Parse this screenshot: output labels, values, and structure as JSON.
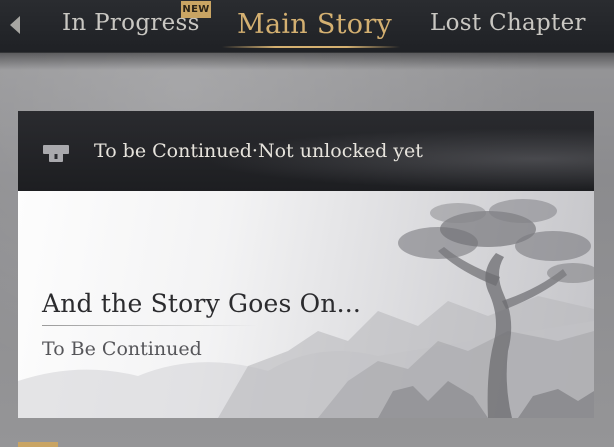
{
  "tabs": {
    "in_progress": "In Progress",
    "main_story": "Main Story",
    "lost_chapter": "Lost Chapter",
    "new_badge": "NEW",
    "active": "main_story"
  },
  "card": {
    "status_text": "To be Continued·Not unlocked yet",
    "title": "And the Story Goes On...",
    "subtitle": "To Be Continued",
    "lock_icon": "lock-icon"
  },
  "colors": {
    "accent_gold": "#d4b071",
    "badge_gold": "#c9a463",
    "header_dark": "#1f2125"
  }
}
